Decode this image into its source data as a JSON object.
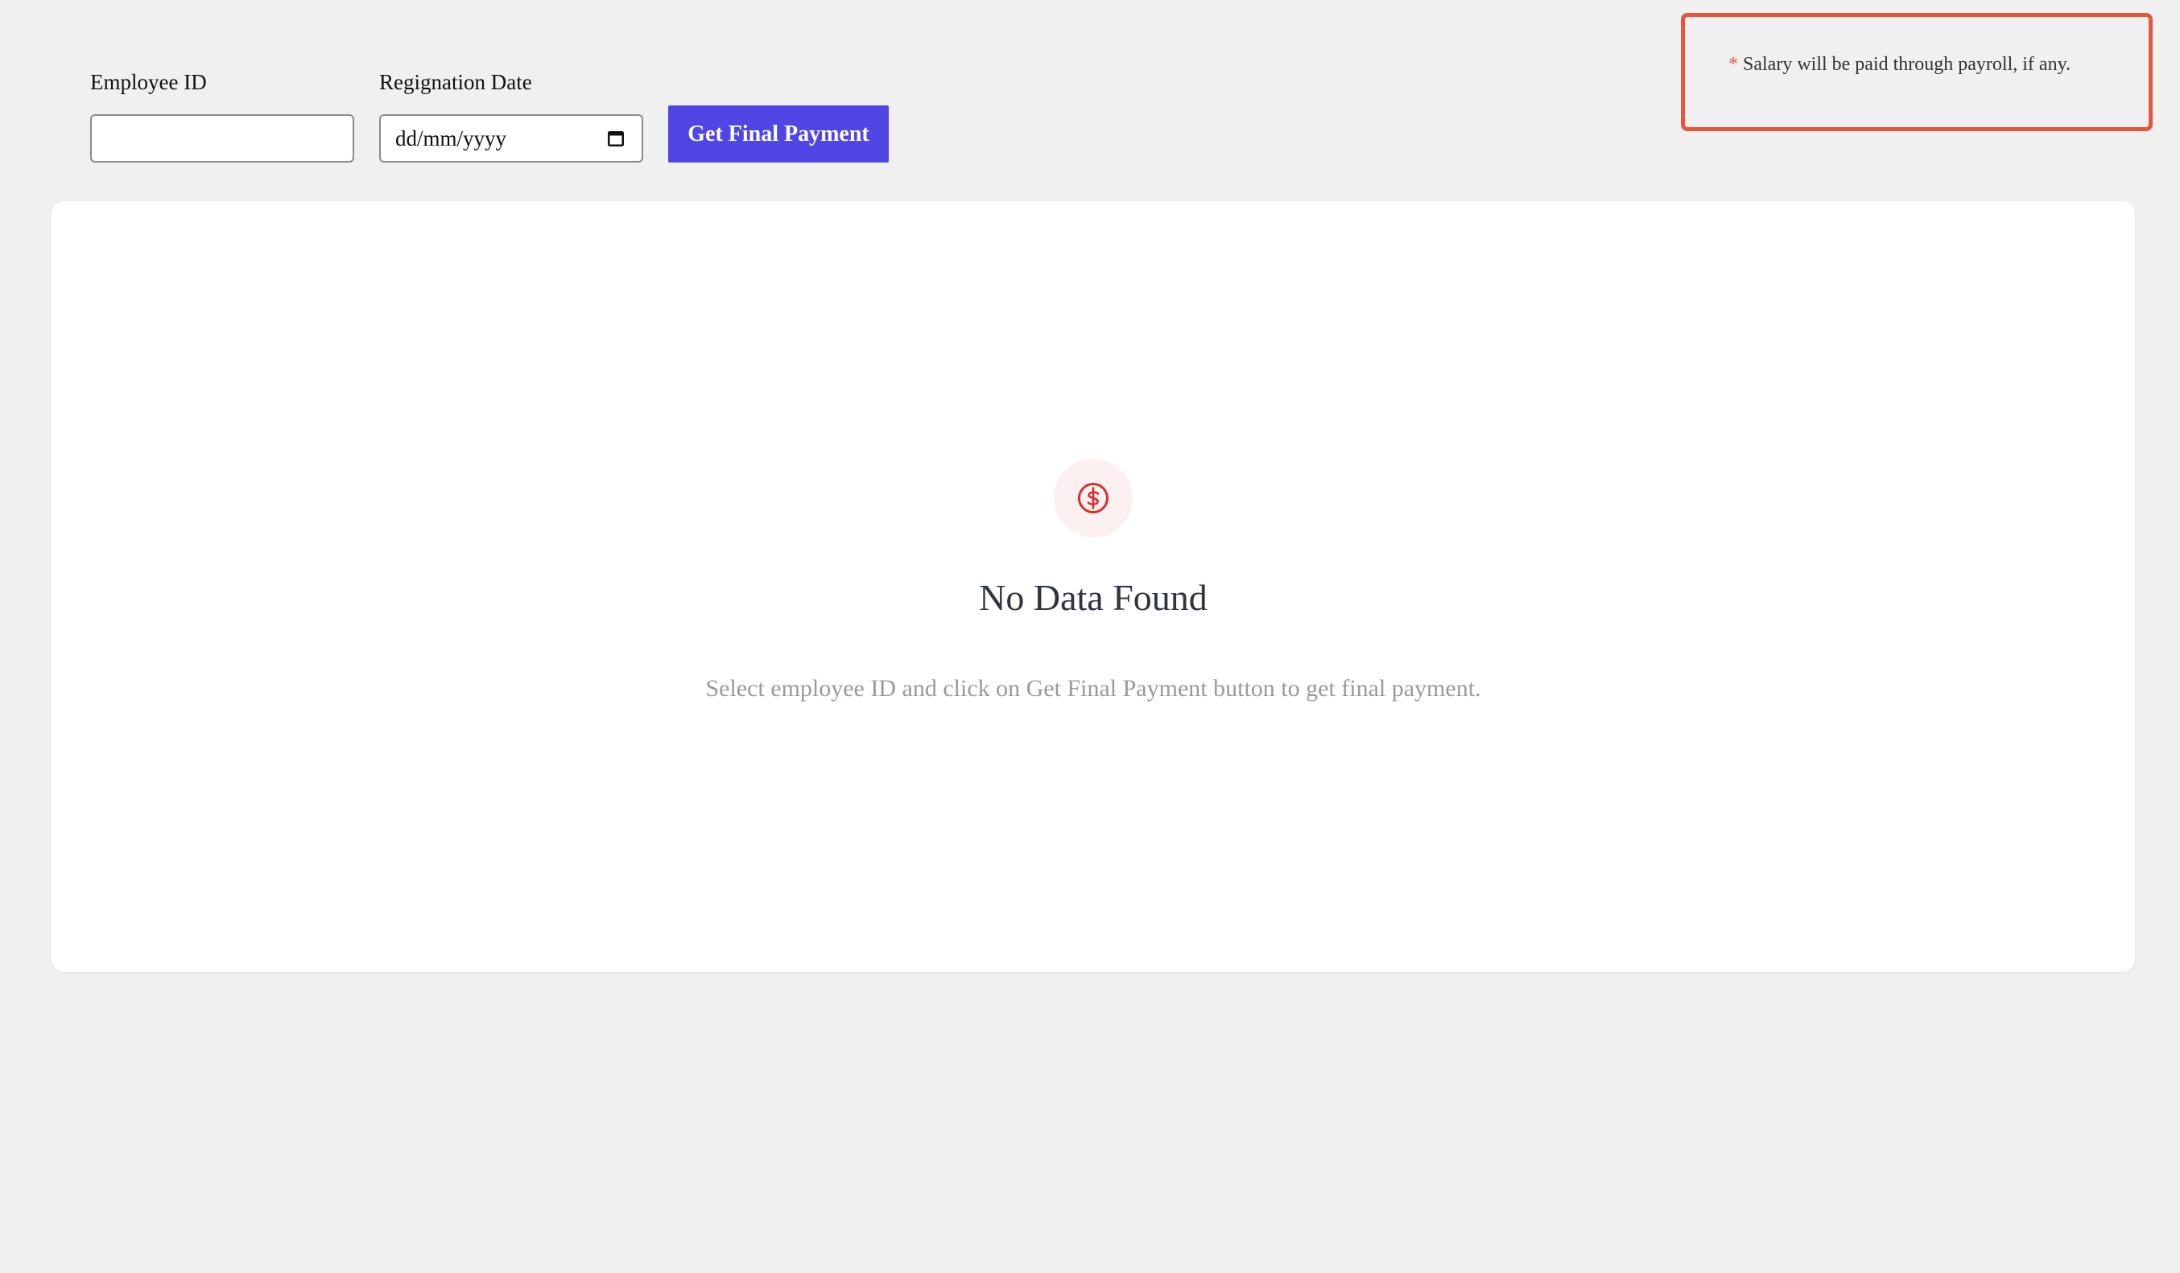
{
  "form": {
    "employee_id": {
      "label": "Employee ID",
      "value": "",
      "placeholder": ""
    },
    "resignation_date": {
      "label": "Regignation Date",
      "placeholder": "dd/mm/yyyy",
      "icon": "calendar-icon"
    },
    "submit_label": "Get Final Payment"
  },
  "notice": {
    "asterisk": "*",
    "text": "Salary will be paid through payroll, if any.",
    "border_color": "#e8553d"
  },
  "empty_state": {
    "icon": "dollar-circle-icon",
    "title": "No Data Found",
    "description": "Select employee ID and click on Get Final Payment button to get final payment."
  },
  "colors": {
    "accent": "#4f46e5",
    "icon_red": "#d62f2f",
    "icon_bg": "#fdf0f0",
    "background": "#f0f0f0"
  }
}
